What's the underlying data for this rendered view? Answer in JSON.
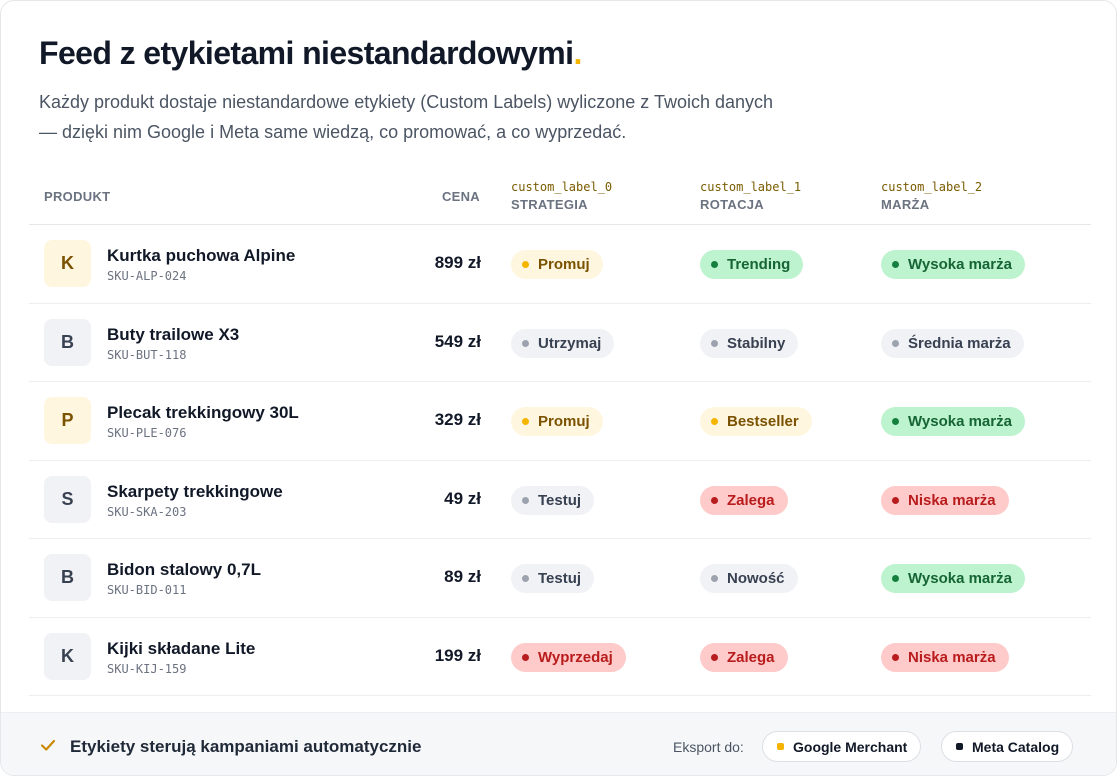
{
  "header": {
    "title": "Feed z etykietami niestandardowymi",
    "title_dot": ".",
    "subtitle_line1": "Każdy produkt dostaje niestandardowe etykiety (Custom Labels) wyliczone z Twoich danych",
    "subtitle_line2": "— dzięki nim Google i Meta same wiedzą, co promować, a co wyprzedać."
  },
  "table": {
    "columns": {
      "product": "PRODUKT",
      "price": "CENA",
      "label0_code": "custom_label_0",
      "label0_name": "STRATEGIA",
      "label1_code": "custom_label_1",
      "label1_name": "ROTACJA",
      "label2_code": "custom_label_2",
      "label2_name": "MARŻA"
    },
    "rows": [
      {
        "initial": "K",
        "tone": "yellow",
        "name": "Kurtka puchowa Alpine",
        "sku": "SKU-ALP-024",
        "price": "899 zł",
        "l0": {
          "text": "Promuj",
          "tone": "yellow"
        },
        "l1": {
          "text": "Trending",
          "tone": "green"
        },
        "l2": {
          "text": "Wysoka marża",
          "tone": "green"
        }
      },
      {
        "initial": "B",
        "tone": "gray",
        "name": "Buty trailowe X3",
        "sku": "SKU-BUT-118",
        "price": "549 zł",
        "l0": {
          "text": "Utrzymaj",
          "tone": "gray"
        },
        "l1": {
          "text": "Stabilny",
          "tone": "gray"
        },
        "l2": {
          "text": "Średnia marża",
          "tone": "gray"
        }
      },
      {
        "initial": "P",
        "tone": "yellow",
        "name": "Plecak trekkingowy 30L",
        "sku": "SKU-PLE-076",
        "price": "329 zł",
        "l0": {
          "text": "Promuj",
          "tone": "yellow"
        },
        "l1": {
          "text": "Bestseller",
          "tone": "yellow"
        },
        "l2": {
          "text": "Wysoka marża",
          "tone": "green"
        }
      },
      {
        "initial": "S",
        "tone": "gray",
        "name": "Skarpety trekkingowe",
        "sku": "SKU-SKA-203",
        "price": "49 zł",
        "l0": {
          "text": "Testuj",
          "tone": "gray"
        },
        "l1": {
          "text": "Zalega",
          "tone": "red"
        },
        "l2": {
          "text": "Niska marża",
          "tone": "red"
        }
      },
      {
        "initial": "B",
        "tone": "gray",
        "name": "Bidon stalowy 0,7L",
        "sku": "SKU-BID-011",
        "price": "89 zł",
        "l0": {
          "text": "Testuj",
          "tone": "gray"
        },
        "l1": {
          "text": "Nowość",
          "tone": "gray"
        },
        "l2": {
          "text": "Wysoka marża",
          "tone": "green"
        }
      },
      {
        "initial": "K",
        "tone": "gray",
        "name": "Kijki składane Lite",
        "sku": "SKU-KIJ-159",
        "price": "199 zł",
        "l0": {
          "text": "Wyprzedaj",
          "tone": "red"
        },
        "l1": {
          "text": "Zalega",
          "tone": "red"
        },
        "l2": {
          "text": "Niska marża",
          "tone": "red"
        }
      }
    ]
  },
  "footer": {
    "icon": "check-icon",
    "text": "Etykiety sterują kampaniami automatycznie",
    "export_label": "Eksport do:",
    "export_google": "Google Merchant",
    "export_meta": "Meta Catalog"
  },
  "colors": {
    "accent": "#f5b400",
    "green": "#15803d",
    "red": "#b91c1c",
    "gray": "#9ca3af"
  }
}
